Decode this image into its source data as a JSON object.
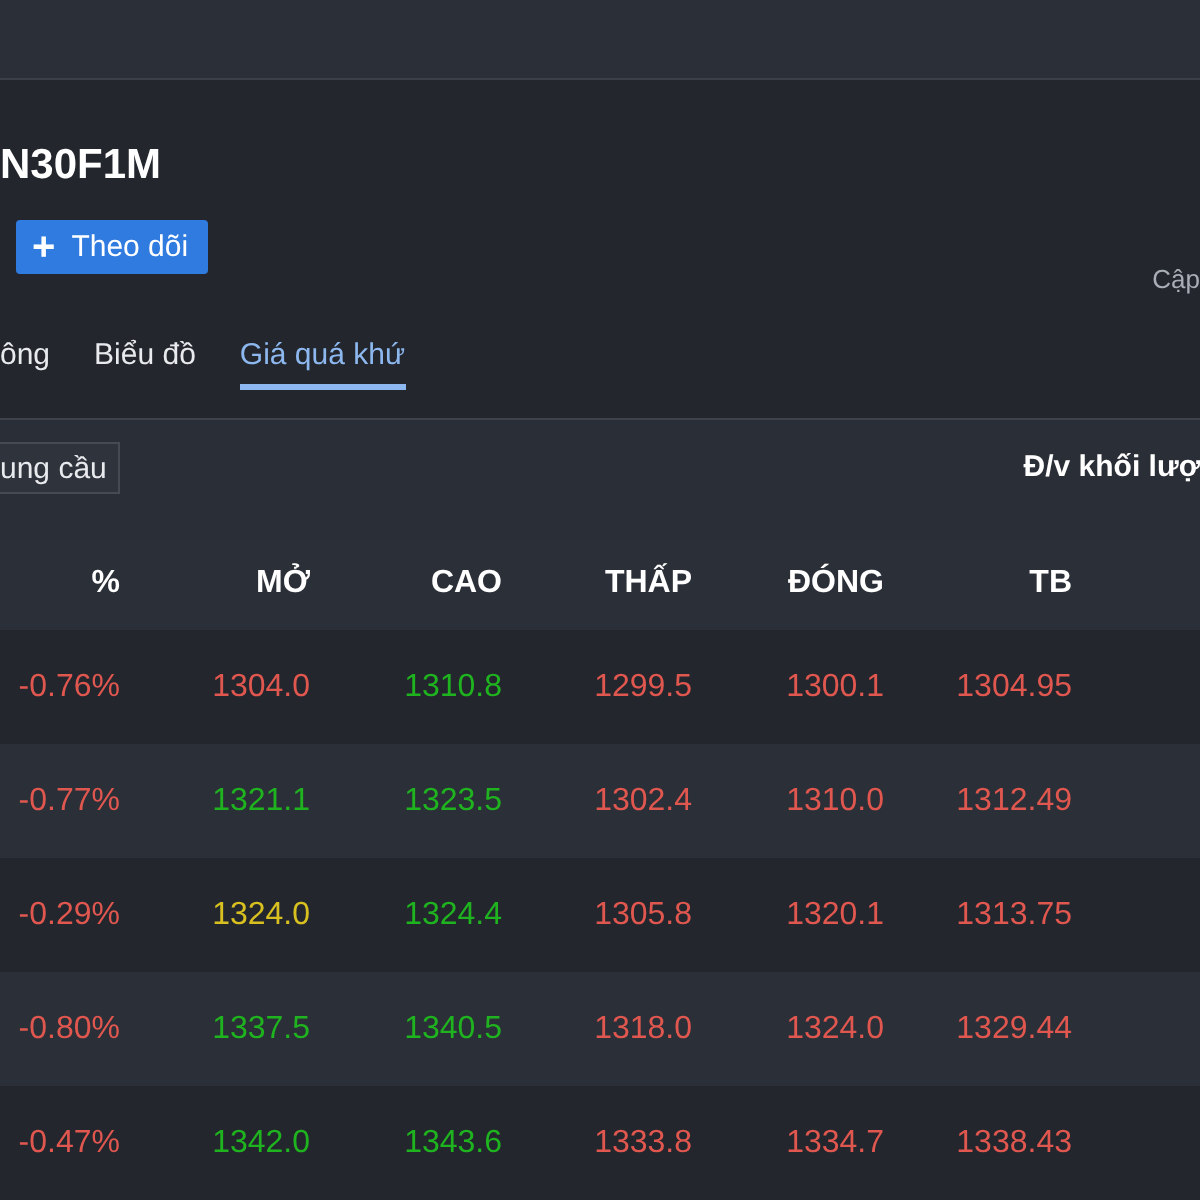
{
  "header": {
    "symbol": "N30F1M",
    "follow_button": {
      "icon": "+",
      "label": "Theo dõi"
    },
    "updated_label": "Cập"
  },
  "tabs": [
    {
      "label": "ông",
      "selected": false
    },
    {
      "label": "Biểu đồ",
      "selected": false
    },
    {
      "label": "Giá quá khứ",
      "selected": true
    }
  ],
  "toolbar": {
    "supply_demand_button": "ung cầu",
    "volume_unit_label": "Đ/v khối lượ"
  },
  "table": {
    "columns": [
      "%",
      "MỞ",
      "CAO",
      "THẤP",
      "ĐÓNG",
      "TB"
    ],
    "rows": [
      [
        {
          "text": "-0.76%",
          "color": "#e0574f"
        },
        {
          "text": "1304.0",
          "color": "#e0574f"
        },
        {
          "text": "1310.8",
          "color": "#1fb31f"
        },
        {
          "text": "1299.5",
          "color": "#e0574f"
        },
        {
          "text": "1300.1",
          "color": "#e0574f"
        },
        {
          "text": "1304.95",
          "color": "#e0574f"
        }
      ],
      [
        {
          "text": "-0.77%",
          "color": "#e0574f"
        },
        {
          "text": "1321.1",
          "color": "#1fb31f"
        },
        {
          "text": "1323.5",
          "color": "#1fb31f"
        },
        {
          "text": "1302.4",
          "color": "#e0574f"
        },
        {
          "text": "1310.0",
          "color": "#e0574f"
        },
        {
          "text": "1312.49",
          "color": "#e0574f"
        }
      ],
      [
        {
          "text": "-0.29%",
          "color": "#e0574f"
        },
        {
          "text": "1324.0",
          "color": "#d8c020"
        },
        {
          "text": "1324.4",
          "color": "#1fb31f"
        },
        {
          "text": "1305.8",
          "color": "#e0574f"
        },
        {
          "text": "1320.1",
          "color": "#e0574f"
        },
        {
          "text": "1313.75",
          "color": "#e0574f"
        }
      ],
      [
        {
          "text": "-0.80%",
          "color": "#e0574f"
        },
        {
          "text": "1337.5",
          "color": "#1fb31f"
        },
        {
          "text": "1340.5",
          "color": "#1fb31f"
        },
        {
          "text": "1318.0",
          "color": "#e0574f"
        },
        {
          "text": "1324.0",
          "color": "#e0574f"
        },
        {
          "text": "1329.44",
          "color": "#e0574f"
        }
      ],
      [
        {
          "text": "-0.47%",
          "color": "#e0574f"
        },
        {
          "text": "1342.0",
          "color": "#1fb31f"
        },
        {
          "text": "1343.6",
          "color": "#1fb31f"
        },
        {
          "text": "1333.8",
          "color": "#e0574f"
        },
        {
          "text": "1334.7",
          "color": "#e0574f"
        },
        {
          "text": "1338.43",
          "color": "#e0574f"
        }
      ]
    ]
  }
}
